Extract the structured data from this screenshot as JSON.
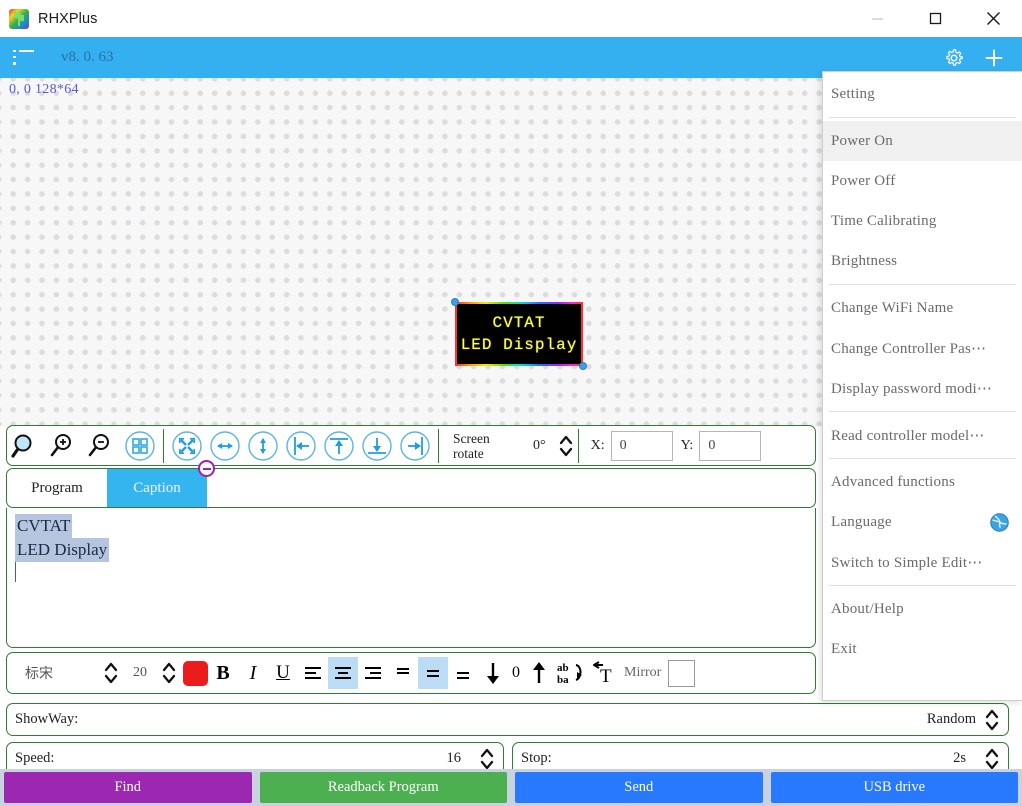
{
  "window": {
    "title": "RHXPlus",
    "app_icon": "plant-logo-icon",
    "minimize": "minimize-icon",
    "maximize": "maximize-icon",
    "close": "close-icon"
  },
  "bluebar": {
    "menu_icon": "list-menu-icon",
    "version": "v8. 0. 63",
    "settings_icon": "gear-icon",
    "add_icon": "plus-icon"
  },
  "canvas": {
    "coord_label": "0, 0  128*64",
    "led_panel": {
      "line1": "CVTAT",
      "line2": "LED Display",
      "text_color": "#ffff4a",
      "background": "#000000"
    }
  },
  "toolbar": {
    "icons": [
      {
        "name": "zoom-fit-icon",
        "glyph": "magnifier"
      },
      {
        "name": "zoom-in-icon",
        "glyph": "magnifier-plus"
      },
      {
        "name": "zoom-out-icon",
        "glyph": "magnifier-minus"
      },
      {
        "name": "grid-view-icon",
        "glyph": "grid"
      },
      {
        "name": "fit-screen-icon",
        "glyph": "expand-arrows"
      },
      {
        "name": "stretch-horizontal-icon",
        "glyph": "left-right-arrow"
      },
      {
        "name": "stretch-vertical-icon",
        "glyph": "up-down-arrow"
      },
      {
        "name": "align-left-icon",
        "glyph": "arrow-to-left"
      },
      {
        "name": "align-top-icon",
        "glyph": "arrow-to-top"
      },
      {
        "name": "align-bottom-icon",
        "glyph": "arrow-to-bottom"
      },
      {
        "name": "align-right-icon",
        "glyph": "arrow-to-right"
      }
    ],
    "screen_rotate_label": "Screen rotate",
    "screen_rotate_value": "0°",
    "x_label": "X:",
    "x_value": "0",
    "y_label": "Y:",
    "y_value": "0"
  },
  "tabs": {
    "program": "Program",
    "caption": "Caption",
    "close_icon": "remove-tab-icon"
  },
  "editor": {
    "line1": "CVTAT",
    "line2": "LED Display"
  },
  "font_toolbar": {
    "font_name": "标宋",
    "font_size": "20",
    "color": "#ec1c1c",
    "bold": "B",
    "italic": "I",
    "underline": "U",
    "align_left": "align-left-icon",
    "align_center": "align-center-icon",
    "align_right": "align-right-icon",
    "align_justify": "align-justify-icon",
    "valign_top": "valign-top-icon",
    "valign_middle": "valign-middle-icon",
    "valign_bottom": "valign-bottom-icon",
    "line_down": "move-down-icon",
    "line_spacing_value": "0",
    "line_up": "move-up-icon",
    "reverse": "reverse-text-icon",
    "rotate_text": "rotate-text-icon",
    "mirror_label": "Mirror",
    "mirror_checked": false
  },
  "showway": {
    "label": "ShowWay:",
    "value": "Random"
  },
  "speed": {
    "label": "Speed:",
    "value": "16"
  },
  "stop": {
    "label": "Stop:",
    "value": "2s"
  },
  "bottom_buttons": [
    {
      "label": "Find",
      "color": "#9c27b0",
      "name": "find-button"
    },
    {
      "label": "Readback Program",
      "color": "#4caf50",
      "name": "readback-program-button"
    },
    {
      "label": "Send",
      "color": "#2979ff",
      "name": "send-button"
    },
    {
      "label": "USB drive",
      "color": "#2979ff",
      "name": "usb-drive-button"
    }
  ],
  "side_menu": {
    "items": [
      {
        "label": "Setting",
        "name": "menu-setting",
        "highlight": false,
        "sep_after": true
      },
      {
        "label": "Power On",
        "name": "menu-power-on",
        "highlight": true,
        "sep_after": false
      },
      {
        "label": "Power Off",
        "name": "menu-power-off",
        "highlight": false,
        "sep_after": false
      },
      {
        "label": "Time Calibrating",
        "name": "menu-time-calibrating",
        "highlight": false,
        "sep_after": false
      },
      {
        "label": "Brightness",
        "name": "menu-brightness",
        "highlight": false,
        "sep_after": true
      },
      {
        "label": "Change WiFi Name",
        "name": "menu-change-wifi-name",
        "highlight": false,
        "sep_after": false
      },
      {
        "label": "Change Controller Pas⋯",
        "name": "menu-change-controller-password",
        "highlight": false,
        "sep_after": false
      },
      {
        "label": "Display password modi⋯",
        "name": "menu-display-password-modify",
        "highlight": false,
        "sep_after": true
      },
      {
        "label": "Read controller model⋯",
        "name": "menu-read-controller-model",
        "highlight": false,
        "sep_after": true
      },
      {
        "label": "Advanced functions",
        "name": "menu-advanced-functions",
        "highlight": false,
        "sep_after": false
      },
      {
        "label": "Language",
        "name": "menu-language",
        "highlight": false,
        "sep_after": false,
        "icon": "globe-icon"
      },
      {
        "label": "Switch to Simple Edit⋯",
        "name": "menu-switch-to-simple-edit",
        "highlight": false,
        "sep_after": true
      },
      {
        "label": "About/Help",
        "name": "menu-about-help",
        "highlight": false,
        "sep_after": false
      },
      {
        "label": "Exit",
        "name": "menu-exit",
        "highlight": false,
        "sep_after": false
      }
    ]
  }
}
